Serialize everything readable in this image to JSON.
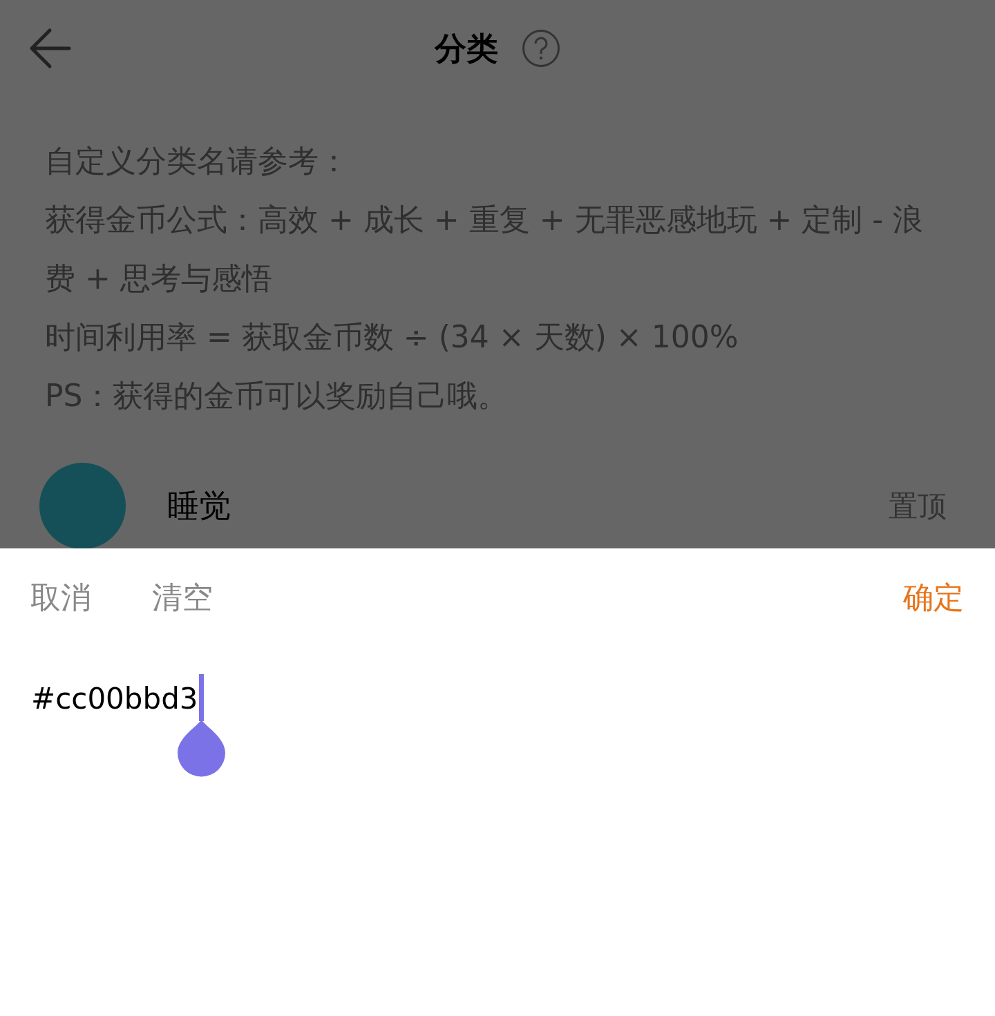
{
  "header": {
    "title": "分类"
  },
  "intro_lines": [
    "自定义分类名请参考：",
    "获得金币公式：高效 + 成长 + 重复 + 无罪恶感地玩 + 定制 - 浪费 + 思考与感悟",
    "时间利用率 = 获取金币数 ÷ (34 × 天数) × 100%",
    "PS：获得的金币可以奖励自己哦。"
  ],
  "categories": [
    {
      "name": "睡觉",
      "color": "#155058",
      "action": "置顶"
    }
  ],
  "sheet": {
    "buttons": [
      {
        "label": "取消",
        "kind": "plain"
      },
      {
        "label": "清空",
        "kind": "plain"
      },
      {
        "label": "确定",
        "kind": "primary"
      }
    ],
    "input": {
      "value": "#cc00bbd3"
    }
  }
}
